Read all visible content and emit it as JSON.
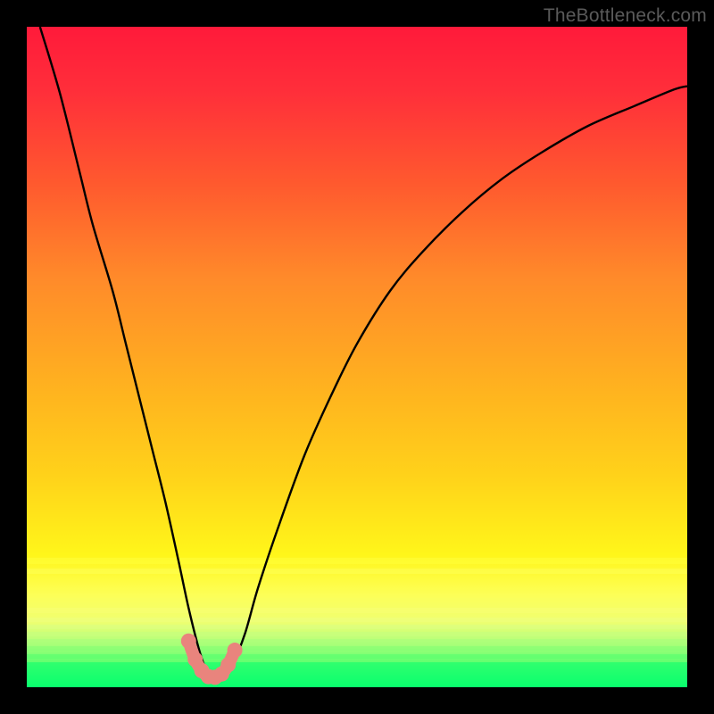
{
  "watermark": "TheBottleneck.com",
  "colors": {
    "background": "#000000",
    "gradient_top": "#ff1a3a",
    "gradient_bottom": "#0aff6e",
    "curve": "#000000",
    "marker": "#e9847d"
  },
  "chart_data": {
    "type": "line",
    "title": "",
    "xlabel": "",
    "ylabel": "",
    "xlim": [
      0,
      100
    ],
    "ylim": [
      0,
      100
    ],
    "grid": false,
    "legend": false,
    "annotations": [],
    "series": [
      {
        "name": "bottleneck-curve",
        "x": [
          2,
          5,
          8,
          10,
          13,
          15,
          17,
          19,
          21,
          23,
          24.5,
          26,
          27,
          28,
          29,
          30,
          31,
          33,
          35,
          38,
          42,
          46,
          50,
          55,
          60,
          66,
          72,
          78,
          85,
          92,
          98,
          100
        ],
        "values": [
          100,
          90,
          78,
          70,
          60,
          52,
          44,
          36,
          28,
          19,
          12,
          6,
          3,
          1.5,
          1.2,
          1.5,
          3,
          8,
          15,
          24,
          35,
          44,
          52,
          60,
          66,
          72,
          77,
          81,
          85,
          88,
          90.5,
          91
        ]
      }
    ],
    "markers": {
      "name": "valley-markers",
      "x": [
        24.5,
        25.5,
        26.5,
        27.5,
        28.5,
        29.5,
        30.5,
        31.5
      ],
      "values": [
        7,
        4.2,
        2.5,
        1.6,
        1.5,
        2.0,
        3.4,
        5.6
      ]
    }
  }
}
